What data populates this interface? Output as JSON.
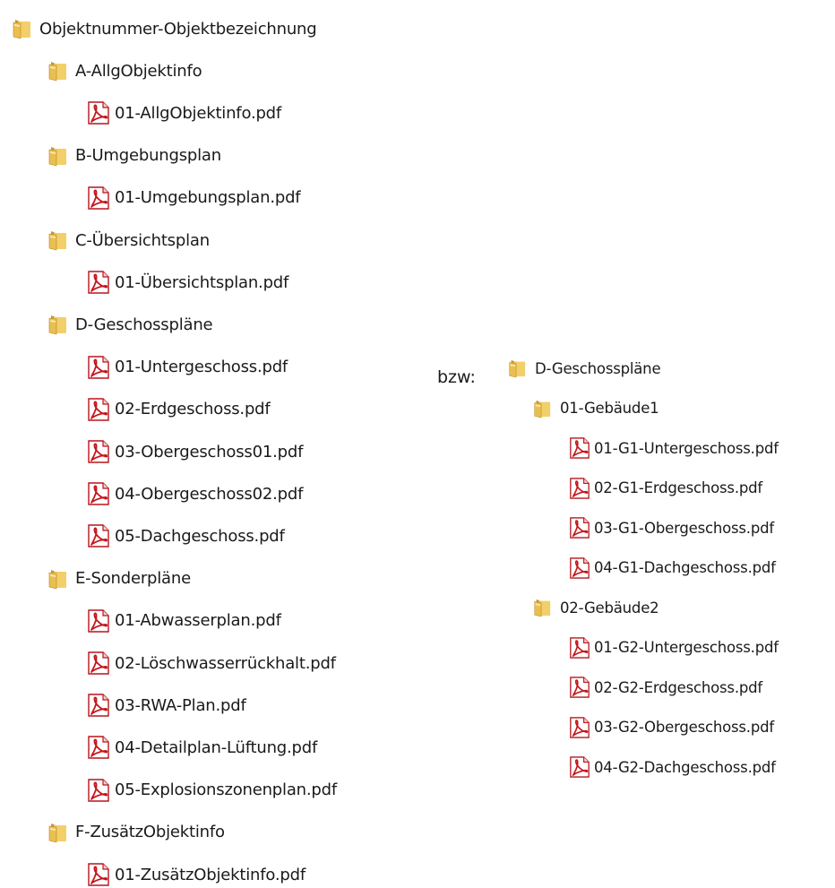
{
  "left_tree": {
    "root": {
      "label": "Objektnummer-Objektbezeichnung",
      "icon": "folder-icon"
    },
    "folders": [
      {
        "label": "A-AllgObjektinfo",
        "icon": "folder-icon",
        "files": [
          {
            "label": "01-AllgObjektinfo.pdf",
            "icon": "pdf-icon"
          }
        ]
      },
      {
        "label": "B-Umgebungsplan",
        "icon": "folder-icon",
        "files": [
          {
            "label": "01-Umgebungsplan.pdf",
            "icon": "pdf-icon"
          }
        ]
      },
      {
        "label": "C-Übersichtsplan",
        "icon": "folder-icon",
        "files": [
          {
            "label": "01-Übersichtsplan.pdf",
            "icon": "pdf-icon"
          }
        ]
      },
      {
        "label": "D-Geschosspläne",
        "icon": "folder-icon",
        "files": [
          {
            "label": "01-Untergeschoss.pdf",
            "icon": "pdf-icon"
          },
          {
            "label": "02-Erdgeschoss.pdf",
            "icon": "pdf-icon"
          },
          {
            "label": "03-Obergeschoss01.pdf",
            "icon": "pdf-icon"
          },
          {
            "label": "04-Obergeschoss02.pdf",
            "icon": "pdf-icon"
          },
          {
            "label": "05-Dachgeschoss.pdf",
            "icon": "pdf-icon"
          }
        ]
      },
      {
        "label": "E-Sonderpläne",
        "icon": "folder-icon",
        "files": [
          {
            "label": "01-Abwasserplan.pdf",
            "icon": "pdf-icon"
          },
          {
            "label": "02-Löschwasserrückhalt.pdf",
            "icon": "pdf-icon"
          },
          {
            "label": "03-RWA-Plan.pdf",
            "icon": "pdf-icon"
          },
          {
            "label": "04-Detailplan-Lüftung.pdf",
            "icon": "pdf-icon"
          },
          {
            "label": "05-Explosionszonenplan.pdf",
            "icon": "pdf-icon"
          }
        ]
      },
      {
        "label": "F-ZusätzObjektinfo",
        "icon": "folder-icon",
        "files": [
          {
            "label": "01-ZusätzObjektinfo.pdf",
            "icon": "pdf-icon"
          }
        ]
      }
    ]
  },
  "alternative": {
    "prefix": "bzw:",
    "root": {
      "label": "D-Geschosspläne",
      "icon": "folder-icon"
    },
    "folders": [
      {
        "label": "01-Gebäude1",
        "icon": "folder-icon",
        "files": [
          {
            "label": "01-G1-Untergeschoss.pdf",
            "icon": "pdf-icon"
          },
          {
            "label": "02-G1-Erdgeschoss.pdf",
            "icon": "pdf-icon"
          },
          {
            "label": "03-G1-Obergeschoss.pdf",
            "icon": "pdf-icon"
          },
          {
            "label": "04-G1-Dachgeschoss.pdf",
            "icon": "pdf-icon"
          }
        ]
      },
      {
        "label": "02-Gebäude2",
        "icon": "folder-icon",
        "files": [
          {
            "label": "01-G2-Untergeschoss.pdf",
            "icon": "pdf-icon"
          },
          {
            "label": "02-G2-Erdgeschoss.pdf",
            "icon": "pdf-icon"
          },
          {
            "label": "03-G2-Obergeschoss.pdf",
            "icon": "pdf-icon"
          },
          {
            "label": "04-G2-Dachgeschoss.pdf",
            "icon": "pdf-icon"
          }
        ]
      }
    ]
  },
  "colors": {
    "folder": "#e9bf4f",
    "folder_dark": "#c8962a",
    "pdf_red": "#c4161c"
  }
}
